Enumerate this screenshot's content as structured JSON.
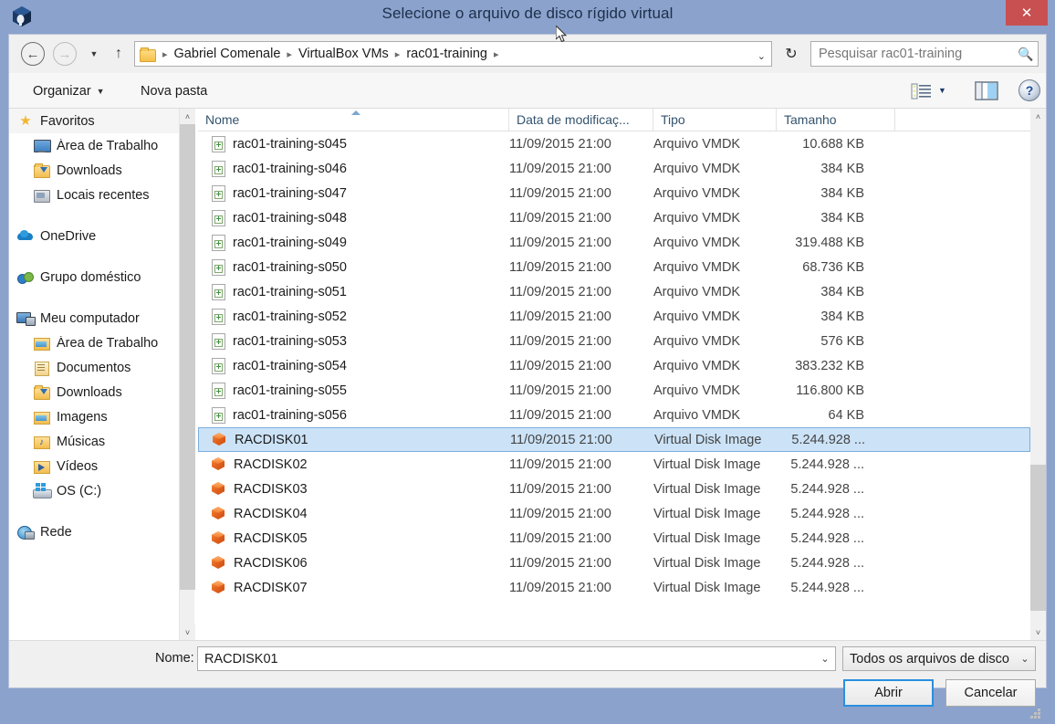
{
  "window": {
    "title": "Selecione o arquivo de disco rígido virtual",
    "app_icon": "virtualbox-cube-icon",
    "close_label": "✕",
    "accent_close": "#c85050",
    "titlebar_bg": "#8ba2cc",
    "selection_bg": "#cce3f7"
  },
  "address_bar": {
    "back_icon": "←",
    "forward_icon": "→",
    "recent_icon": "▼",
    "up_icon": "↑",
    "refresh_icon": "↻",
    "dropdown_icon": "⌄",
    "separator": "▸",
    "crumbs": [
      "Gabriel Comenale",
      "VirtualBox VMs",
      "rac01-training"
    ]
  },
  "search": {
    "placeholder": "Pesquisar rac01-training",
    "icon": "search-icon",
    "value": ""
  },
  "command_bar": {
    "organizar_label": "Organizar",
    "organizar_caret": "▼",
    "nova_pasta_label": "Nova pasta",
    "view_icon": "list-view-icon",
    "view_caret": "▼",
    "preview_pane_icon": "preview-pane-icon",
    "help_label": "?"
  },
  "sidebar": {
    "items": [
      {
        "label": "Favoritos",
        "icon": "star-icon",
        "indent": 8,
        "header": true
      },
      {
        "label": "Área de Trabalho",
        "icon": "desktop-icon",
        "indent": 26
      },
      {
        "label": "Downloads",
        "icon": "downloads-folder-icon",
        "indent": 26
      },
      {
        "label": "Locais recentes",
        "icon": "recent-places-icon",
        "indent": 26
      },
      {
        "label": "OneDrive",
        "icon": "cloud-icon",
        "indent": 8,
        "gap_before": true
      },
      {
        "label": "Grupo doméstico",
        "icon": "homegroup-icon",
        "indent": 8,
        "gap_before": true
      },
      {
        "label": "Meu computador",
        "icon": "computer-icon",
        "indent": 8,
        "gap_before": true
      },
      {
        "label": "Área de Trabalho",
        "icon": "desktop-folder-icon",
        "indent": 26
      },
      {
        "label": "Documentos",
        "icon": "documents-folder-icon",
        "indent": 26
      },
      {
        "label": "Downloads",
        "icon": "downloads-folder-icon",
        "indent": 26
      },
      {
        "label": "Imagens",
        "icon": "pictures-folder-icon",
        "indent": 26
      },
      {
        "label": "Músicas",
        "icon": "music-folder-icon",
        "indent": 26
      },
      {
        "label": "Vídeos",
        "icon": "videos-folder-icon",
        "indent": 26
      },
      {
        "label": "OS (C:)",
        "icon": "drive-icon",
        "indent": 26
      },
      {
        "label": "Rede",
        "icon": "network-icon",
        "indent": 8,
        "gap_before": true
      }
    ],
    "scrollbar": {
      "up_icon": "˄",
      "down_icon": "˅"
    }
  },
  "file_list": {
    "columns": [
      "Nome",
      "Data de modificaç...",
      "Tipo",
      "Tamanho"
    ],
    "sort_column": "Nome",
    "sort_direction": "ascending",
    "scrollbar": {
      "up_icon": "˄",
      "down_icon": "˅"
    },
    "rows": [
      {
        "name": "rac01-training-s045",
        "date": "11/09/2015 21:00",
        "type": "Arquivo VMDK",
        "size": "10.688 KB",
        "icon": "vmdk-file-icon",
        "selected": false
      },
      {
        "name": "rac01-training-s046",
        "date": "11/09/2015 21:00",
        "type": "Arquivo VMDK",
        "size": "384 KB",
        "icon": "vmdk-file-icon",
        "selected": false
      },
      {
        "name": "rac01-training-s047",
        "date": "11/09/2015 21:00",
        "type": "Arquivo VMDK",
        "size": "384 KB",
        "icon": "vmdk-file-icon",
        "selected": false
      },
      {
        "name": "rac01-training-s048",
        "date": "11/09/2015 21:00",
        "type": "Arquivo VMDK",
        "size": "384 KB",
        "icon": "vmdk-file-icon",
        "selected": false
      },
      {
        "name": "rac01-training-s049",
        "date": "11/09/2015 21:00",
        "type": "Arquivo VMDK",
        "size": "319.488 KB",
        "icon": "vmdk-file-icon",
        "selected": false
      },
      {
        "name": "rac01-training-s050",
        "date": "11/09/2015 21:00",
        "type": "Arquivo VMDK",
        "size": "68.736 KB",
        "icon": "vmdk-file-icon",
        "selected": false
      },
      {
        "name": "rac01-training-s051",
        "date": "11/09/2015 21:00",
        "type": "Arquivo VMDK",
        "size": "384 KB",
        "icon": "vmdk-file-icon",
        "selected": false
      },
      {
        "name": "rac01-training-s052",
        "date": "11/09/2015 21:00",
        "type": "Arquivo VMDK",
        "size": "384 KB",
        "icon": "vmdk-file-icon",
        "selected": false
      },
      {
        "name": "rac01-training-s053",
        "date": "11/09/2015 21:00",
        "type": "Arquivo VMDK",
        "size": "576 KB",
        "icon": "vmdk-file-icon",
        "selected": false
      },
      {
        "name": "rac01-training-s054",
        "date": "11/09/2015 21:00",
        "type": "Arquivo VMDK",
        "size": "383.232 KB",
        "icon": "vmdk-file-icon",
        "selected": false
      },
      {
        "name": "rac01-training-s055",
        "date": "11/09/2015 21:00",
        "type": "Arquivo VMDK",
        "size": "116.800 KB",
        "icon": "vmdk-file-icon",
        "selected": false
      },
      {
        "name": "rac01-training-s056",
        "date": "11/09/2015 21:00",
        "type": "Arquivo VMDK",
        "size": "64 KB",
        "icon": "vmdk-file-icon",
        "selected": false
      },
      {
        "name": "RACDISK01",
        "date": "11/09/2015 21:00",
        "type": "Virtual Disk Image",
        "size": "5.244.928 ...",
        "icon": "vdi-disk-icon",
        "selected": true
      },
      {
        "name": "RACDISK02",
        "date": "11/09/2015 21:00",
        "type": "Virtual Disk Image",
        "size": "5.244.928 ...",
        "icon": "vdi-disk-icon",
        "selected": false
      },
      {
        "name": "RACDISK03",
        "date": "11/09/2015 21:00",
        "type": "Virtual Disk Image",
        "size": "5.244.928 ...",
        "icon": "vdi-disk-icon",
        "selected": false
      },
      {
        "name": "RACDISK04",
        "date": "11/09/2015 21:00",
        "type": "Virtual Disk Image",
        "size": "5.244.928 ...",
        "icon": "vdi-disk-icon",
        "selected": false
      },
      {
        "name": "RACDISK05",
        "date": "11/09/2015 21:00",
        "type": "Virtual Disk Image",
        "size": "5.244.928 ...",
        "icon": "vdi-disk-icon",
        "selected": false
      },
      {
        "name": "RACDISK06",
        "date": "11/09/2015 21:00",
        "type": "Virtual Disk Image",
        "size": "5.244.928 ...",
        "icon": "vdi-disk-icon",
        "selected": false
      },
      {
        "name": "RACDISK07",
        "date": "11/09/2015 21:00",
        "type": "Virtual Disk Image",
        "size": "5.244.928 ...",
        "icon": "vdi-disk-icon",
        "selected": false
      }
    ]
  },
  "footer": {
    "name_label": "Nome:",
    "name_value": "RACDISK01",
    "name_caret": "⌄",
    "filter_value": "Todos os arquivos de disco",
    "filter_caret": "⌄",
    "open_button": "Abrir",
    "cancel_button": "Cancelar"
  }
}
